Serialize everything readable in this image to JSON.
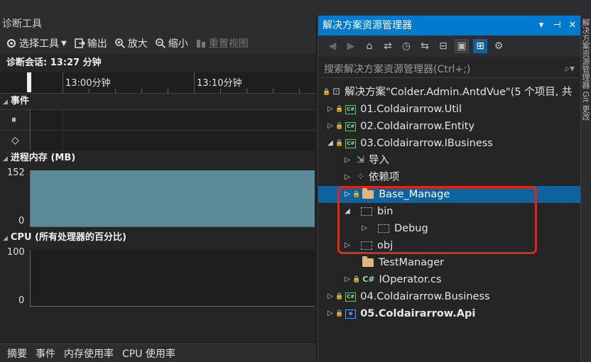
{
  "diagnostics": {
    "title": "诊断工具",
    "toolbar": {
      "select_tools": "选择工具",
      "output": "输出",
      "zoom_in": "放大",
      "zoom_out": "缩小",
      "reset_view": "重置视图"
    },
    "session": "诊断会话: 13:27 分钟",
    "timeline_ticks": [
      "13:00分钟",
      "13:10分钟"
    ],
    "events_label": "事件",
    "memory_label": "进程内存 (MB)",
    "memory_y": [
      "152",
      "0"
    ],
    "cpu_label": "CPU (所有处理器的百分比)",
    "cpu_y": [
      "100",
      "0"
    ],
    "bottom_tabs": [
      "摘要",
      "事件",
      "内存使用率",
      "CPU 使用率"
    ]
  },
  "solution_explorer": {
    "title": "解决方案资源管理器",
    "window_buttons": [
      "▾",
      "⊣",
      "✕"
    ],
    "search_placeholder": "搜索解决方案资源管理器(Ctrl+;)",
    "tree": [
      {
        "text": "解决方案\"Colder.Admin.AntdVue\"(5 个项目, 共"
      },
      {
        "text": "01.Coldairarrow.Util"
      },
      {
        "text": "02.Coldairarrow.Entity"
      },
      {
        "text": "03.Coldairarrow.IBusiness"
      },
      {
        "text": "导入"
      },
      {
        "text": "依赖项"
      },
      {
        "text": "Base_Manage"
      },
      {
        "text": "bin"
      },
      {
        "text": "Debug"
      },
      {
        "text": "obj"
      },
      {
        "text": "TestManager"
      },
      {
        "text": "IOperator.cs"
      },
      {
        "text": "04.Coldairarrow.Business"
      },
      {
        "text": "05.Coldairarrow.Api"
      }
    ]
  },
  "side_strip": "解决方案资源管理器   Git 更改"
}
